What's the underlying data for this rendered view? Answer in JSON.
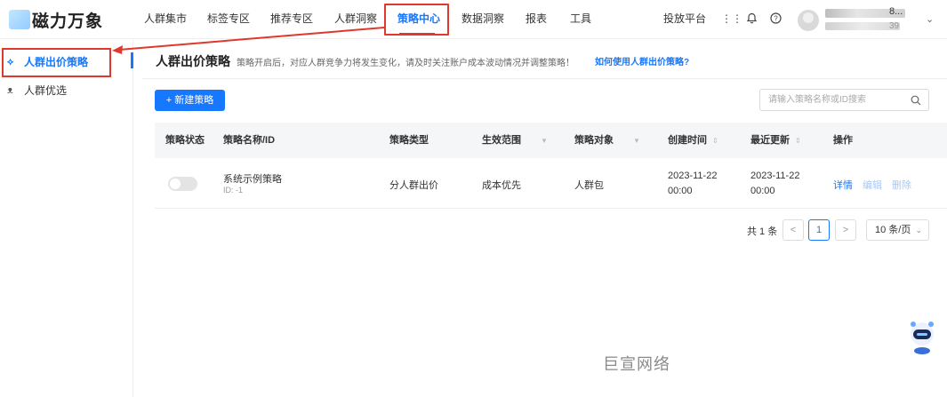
{
  "logo": {
    "text": "磁力万象"
  },
  "nav": {
    "items": [
      {
        "label": "人群集市"
      },
      {
        "label": "标签专区"
      },
      {
        "label": "推荐专区"
      },
      {
        "label": "人群洞察"
      },
      {
        "label": "策略中心"
      },
      {
        "label": "数据洞察"
      },
      {
        "label": "报表"
      },
      {
        "label": "工具"
      }
    ],
    "active_index": 4
  },
  "header_right": {
    "platform_label": "投放平台",
    "user_name_tail": "8...",
    "user_sub_tail": "39"
  },
  "sidebar": {
    "items": [
      {
        "label": "人群出价策略",
        "icon": "strategy-icon",
        "active": true
      },
      {
        "label": "人群优选",
        "icon": "people-icon",
        "active": false
      }
    ]
  },
  "main": {
    "title": "人群出价策略",
    "description": "策略开启后，对应人群竞争力将发生变化，请及时关注账户成本波动情况并调整策略！",
    "help_link": "如何使用人群出价策略?",
    "new_button": "+ 新建策略",
    "search_placeholder": "请输入策略名称或ID搜索"
  },
  "table": {
    "columns": [
      "策略状态",
      "策略名称/ID",
      "策略类型",
      "生效范围",
      "策略对象",
      "创建时间",
      "最近更新",
      "操作"
    ],
    "rows": [
      {
        "status_on": false,
        "name": "系统示例策略",
        "id": "ID: -1",
        "type": "分人群出价",
        "scope": "成本优先",
        "target": "人群包",
        "created_date": "2023-11-22",
        "created_time": "00:00",
        "updated_date": "2023-11-22",
        "updated_time": "00:00",
        "actions": [
          "详情",
          "编辑",
          "删除"
        ]
      }
    ]
  },
  "pagination": {
    "total": "共 1 条",
    "current_page": "1",
    "page_size": "10 条/页",
    "prev": "<",
    "next": ">"
  },
  "watermark": "巨宣网络",
  "colors": {
    "accent": "#1677ff",
    "highlight": "#e0382c"
  }
}
